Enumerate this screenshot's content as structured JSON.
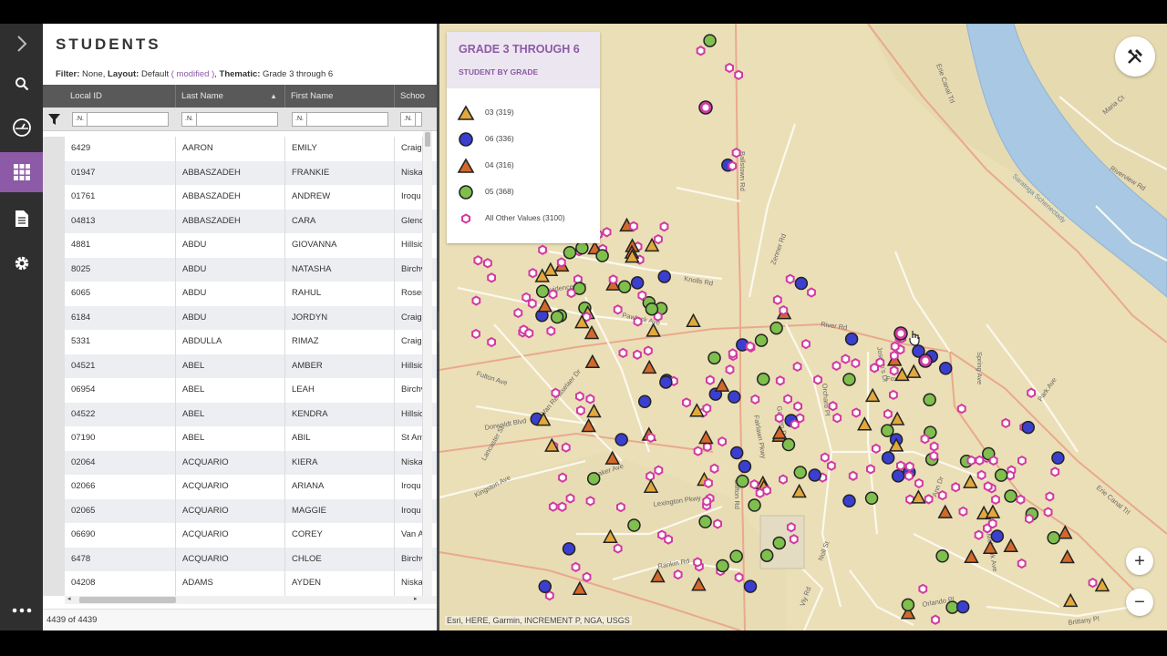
{
  "panel": {
    "title": "STUDENTS",
    "filter_label": "Filter:",
    "filter_value": "None,",
    "layout_label": "Layout:",
    "layout_value": "Default",
    "layout_modified": "( modified )",
    "layout_comma": ",",
    "thematic_label": "Thematic:",
    "thematic_value": "Grade 3 through 6"
  },
  "grid": {
    "columns": [
      "Local ID",
      "Last Name",
      "First Name",
      "Schoo"
    ],
    "filter_prefix": ".N.",
    "rows": [
      {
        "id": "6429",
        "last": "AARON",
        "first": "EMILY",
        "school": "Craig"
      },
      {
        "id": "01947",
        "last": "ABBASZADEH",
        "first": "FRANKIE",
        "school": "Niska"
      },
      {
        "id": "01761",
        "last": "ABBASZADEH",
        "first": "ANDREW",
        "school": "Iroqu"
      },
      {
        "id": "04813",
        "last": "ABBASZADEH",
        "first": "CARA",
        "school": "Glenc"
      },
      {
        "id": "4881",
        "last": "ABDU",
        "first": "GIOVANNA",
        "school": "Hillsic"
      },
      {
        "id": "8025",
        "last": "ABDU",
        "first": "NATASHA",
        "school": "Birchv"
      },
      {
        "id": "6065",
        "last": "ABDU",
        "first": "RAHUL",
        "school": "Roser"
      },
      {
        "id": "6184",
        "last": "ABDU",
        "first": "JORDYN",
        "school": "Craig"
      },
      {
        "id": "5331",
        "last": "ABDULLA",
        "first": "RIMAZ",
        "school": "Craig"
      },
      {
        "id": "04521",
        "last": "ABEL",
        "first": "AMBER",
        "school": "Hillsic"
      },
      {
        "id": "06954",
        "last": "ABEL",
        "first": "LEAH",
        "school": "Birchv"
      },
      {
        "id": "04522",
        "last": "ABEL",
        "first": "KENDRA",
        "school": "Hillsic"
      },
      {
        "id": "07190",
        "last": "ABEL",
        "first": "ABIL",
        "school": "St Am"
      },
      {
        "id": "02064",
        "last": "ACQUARIO",
        "first": "KIERA",
        "school": "Niska"
      },
      {
        "id": "02066",
        "last": "ACQUARIO",
        "first": "ARIANA",
        "school": "Iroqu"
      },
      {
        "id": "02065",
        "last": "ACQUARIO",
        "first": "MAGGIE",
        "school": "Iroqu"
      },
      {
        "id": "06690",
        "last": "ACQUARIO",
        "first": "COREY",
        "school": "Van A"
      },
      {
        "id": "6478",
        "last": "ACQUARIO",
        "first": "CHLOE",
        "school": "Birchv"
      },
      {
        "id": "04208",
        "last": "ADAMS",
        "first": "AYDEN",
        "school": "Niska"
      }
    ]
  },
  "status": {
    "count_text": "4439 of 4439"
  },
  "legend": {
    "title": "GRADE 3 THROUGH 6",
    "subtitle": "STUDENT BY GRADE",
    "items": [
      {
        "label": "03 (319)",
        "shape": "triangle",
        "color": "#e2a83c"
      },
      {
        "label": "06 (336)",
        "shape": "circle",
        "color": "#3b3fd0"
      },
      {
        "label": "04 (316)",
        "shape": "triangle",
        "color": "#d2692b"
      },
      {
        "label": "05 (368)",
        "shape": "circle",
        "color": "#7fbf4d"
      },
      {
        "label": "All Other Values (3100)",
        "shape": "hexagon",
        "color": "#d13aa3"
      }
    ]
  },
  "map": {
    "streets": [
      "Providence Ave",
      "Knolls Rd",
      "Pawluck Ave",
      "River Rd",
      "Fulton Ave",
      "Dorwaldt Blvd",
      "Van Rensselaer Dr",
      "Baker Ave",
      "Lexington Pkwy",
      "Kingston Ave",
      "Ballstown Rd",
      "Zenner Rd",
      "Park Ave",
      "Erie Canal Trl",
      "Riverview Rd",
      "Maria Ct",
      "Brittany Pl",
      "Spring Ave",
      "Lancaster St",
      "Rankin Rd",
      "Fox Ln",
      "Joseph's Dr",
      "Orchard Pl",
      "Garden Dr",
      "Fairlawn Pkwy",
      "Clifton Rd",
      "Vly Rd",
      "Noll St",
      "Orlando Pl",
      "Ann Dr",
      "Mohawk Ave"
    ],
    "river_label": "Saratoga Schenectady",
    "attribution": "Esri, HERE, Garmin, INCREMENT P, NGA, USGS"
  },
  "controls": {
    "zoom_in": "+",
    "zoom_out": "−"
  },
  "icons": {
    "rail": [
      "chevron-right-icon",
      "search-icon",
      "dashboard-icon",
      "grid-icon",
      "document-icon",
      "gear-icon",
      "more-icon"
    ],
    "tools": "tools-icon",
    "filter": "filter-icon"
  },
  "colors": {
    "accent": "#8c5aa6",
    "rail": "#2f2f2f",
    "header": "#595959",
    "map_bg": "#ebdfb7",
    "river": "#a8c8e3"
  }
}
